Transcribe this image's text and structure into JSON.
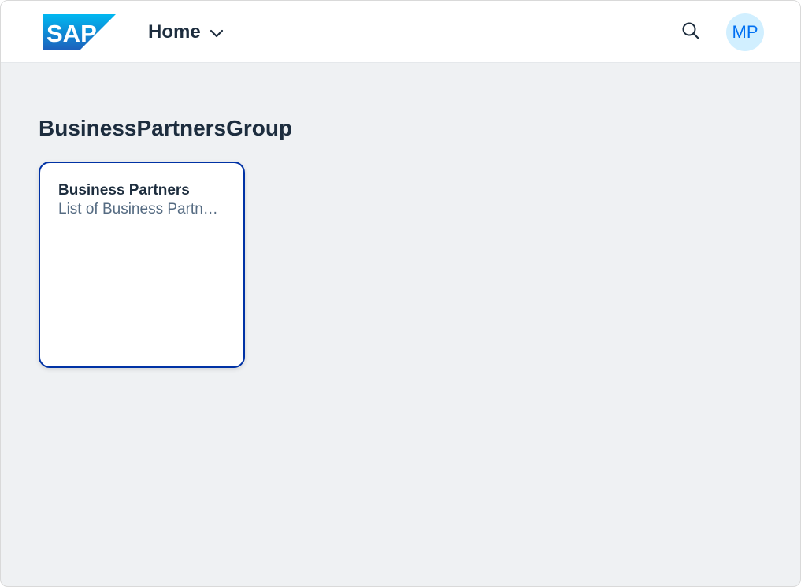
{
  "shell": {
    "logo_text": "SAP",
    "title": "Home",
    "title_icon": "chevron-down-icon",
    "search_icon": "search-icon",
    "avatar_initials": "MP"
  },
  "group": {
    "title": "BusinessPartnersGroup",
    "tiles": [
      {
        "title": "Business Partners",
        "subtitle": "List of Business Partners"
      }
    ]
  },
  "colors": {
    "background": "#eff1f3",
    "header": "#ffffff",
    "tile_border": "#0032a5",
    "avatar_bg": "#d1efff",
    "avatar_text": "#0070f2",
    "logo_gradient_top": "#00b8f1",
    "logo_gradient_bottom": "#1e5fbb"
  }
}
